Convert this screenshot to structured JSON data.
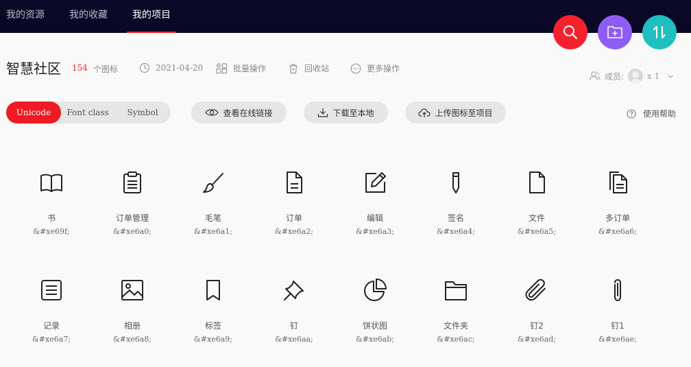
{
  "nav": {
    "tabs": [
      {
        "label": "我的资源"
      },
      {
        "label": "我的收藏"
      },
      {
        "label": "我的项目",
        "active": true
      }
    ]
  },
  "fabs": [
    {
      "icon": "search-icon",
      "color": "#f5222d"
    },
    {
      "icon": "add-folder-icon",
      "color": "#8e5cf7"
    },
    {
      "icon": "sort-icon",
      "color": "#1fbfbf"
    }
  ],
  "project": {
    "name": "智慧社区",
    "count": "154",
    "count_label": "个图标",
    "date": "2021-04-20",
    "batch_label": "批量操作",
    "recycle_label": "回收站",
    "more_label": "更多操作",
    "members_label": "成员:",
    "members_count": "x 1"
  },
  "toolbar": {
    "formats": [
      {
        "label": "Unicode",
        "active": true
      },
      {
        "label": "Font class"
      },
      {
        "label": "Symbol"
      }
    ],
    "view_link": "查看在线链接",
    "download": "下载至本地",
    "upload": "上传图标至项目",
    "help": "使用帮助"
  },
  "icons": [
    {
      "name": "书",
      "code": "&#xe69f;",
      "icon": "book-icon"
    },
    {
      "name": "订单管理",
      "code": "&#xe6a0;",
      "icon": "clipboard-icon"
    },
    {
      "name": "毛笔",
      "code": "&#xe6a1;",
      "icon": "brush-icon"
    },
    {
      "name": "订单",
      "code": "&#xe6a2;",
      "icon": "document-icon"
    },
    {
      "name": "编辑",
      "code": "&#xe6a3;",
      "icon": "edit-icon"
    },
    {
      "name": "签名",
      "code": "&#xe6a4;",
      "icon": "pen-icon"
    },
    {
      "name": "文件",
      "code": "&#xe6a5;",
      "icon": "file-icon"
    },
    {
      "name": "多订单",
      "code": "&#xe6a6;",
      "icon": "multi-document-icon"
    },
    {
      "name": "记录",
      "code": "&#xe6a7;",
      "icon": "record-icon"
    },
    {
      "name": "相册",
      "code": "&#xe6a8;",
      "icon": "image-icon"
    },
    {
      "name": "标签",
      "code": "&#xe6a9;",
      "icon": "bookmark-icon"
    },
    {
      "name": "钉",
      "code": "&#xe6aa;",
      "icon": "pin-icon"
    },
    {
      "name": "饼状图",
      "code": "&#xe6ab;",
      "icon": "pie-chart-icon"
    },
    {
      "name": "文件夹",
      "code": "&#xe6ac;",
      "icon": "folder-icon"
    },
    {
      "name": "钉2",
      "code": "&#xe6ad;",
      "icon": "paperclip-icon"
    },
    {
      "name": "钉1",
      "code": "&#xe6ae;",
      "icon": "paperclip-vertical-icon"
    }
  ]
}
